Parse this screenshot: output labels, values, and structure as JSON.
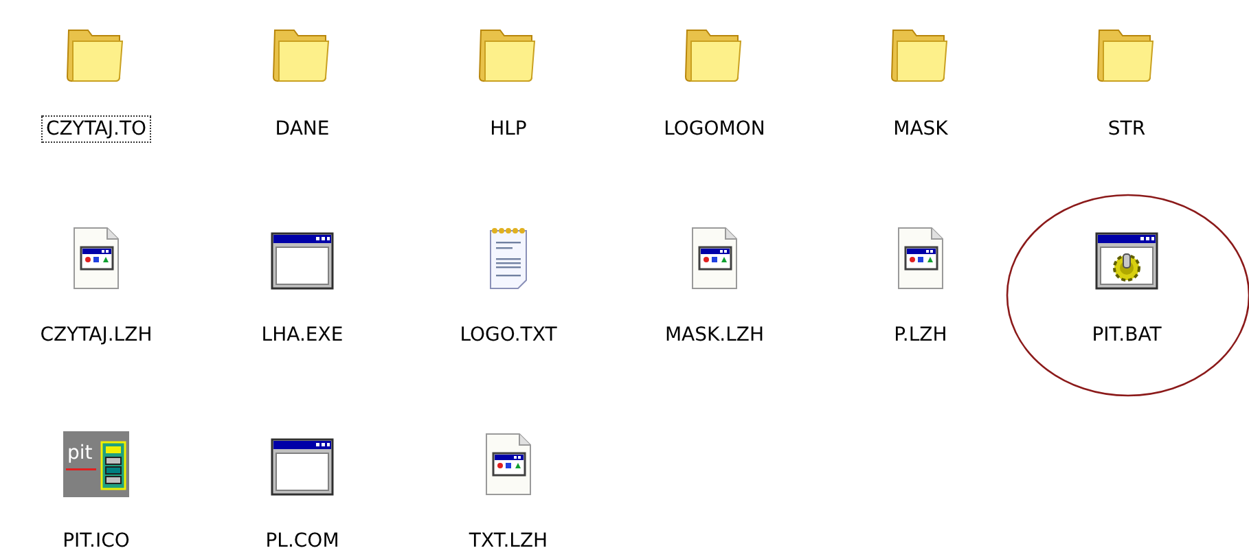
{
  "files": [
    {
      "name": "CZYTAJ.TO",
      "kind": "folder",
      "focused": true,
      "highlighted": false
    },
    {
      "name": "DANE",
      "kind": "folder",
      "focused": false,
      "highlighted": false
    },
    {
      "name": "HLP",
      "kind": "folder",
      "focused": false,
      "highlighted": false
    },
    {
      "name": "LOGOMON",
      "kind": "folder",
      "focused": false,
      "highlighted": false
    },
    {
      "name": "MASK",
      "kind": "folder",
      "focused": false,
      "highlighted": false
    },
    {
      "name": "STR",
      "kind": "folder",
      "focused": false,
      "highlighted": false
    },
    {
      "name": "CZYTAJ.LZH",
      "kind": "archive",
      "focused": false,
      "highlighted": false
    },
    {
      "name": "LHA.EXE",
      "kind": "window",
      "focused": false,
      "highlighted": false
    },
    {
      "name": "LOGO.TXT",
      "kind": "text",
      "focused": false,
      "highlighted": false
    },
    {
      "name": "MASK.LZH",
      "kind": "archive",
      "focused": false,
      "highlighted": false
    },
    {
      "name": "P.LZH",
      "kind": "archive",
      "focused": false,
      "highlighted": false
    },
    {
      "name": "PIT.BAT",
      "kind": "batch",
      "focused": false,
      "highlighted": true
    },
    {
      "name": "PIT.ICO",
      "kind": "ico",
      "icon_text": "pit",
      "focused": false,
      "highlighted": false
    },
    {
      "name": "PL.COM",
      "kind": "window",
      "focused": false,
      "highlighted": false
    },
    {
      "name": "TXT.LZH",
      "kind": "archive",
      "focused": false,
      "highlighted": false
    }
  ]
}
